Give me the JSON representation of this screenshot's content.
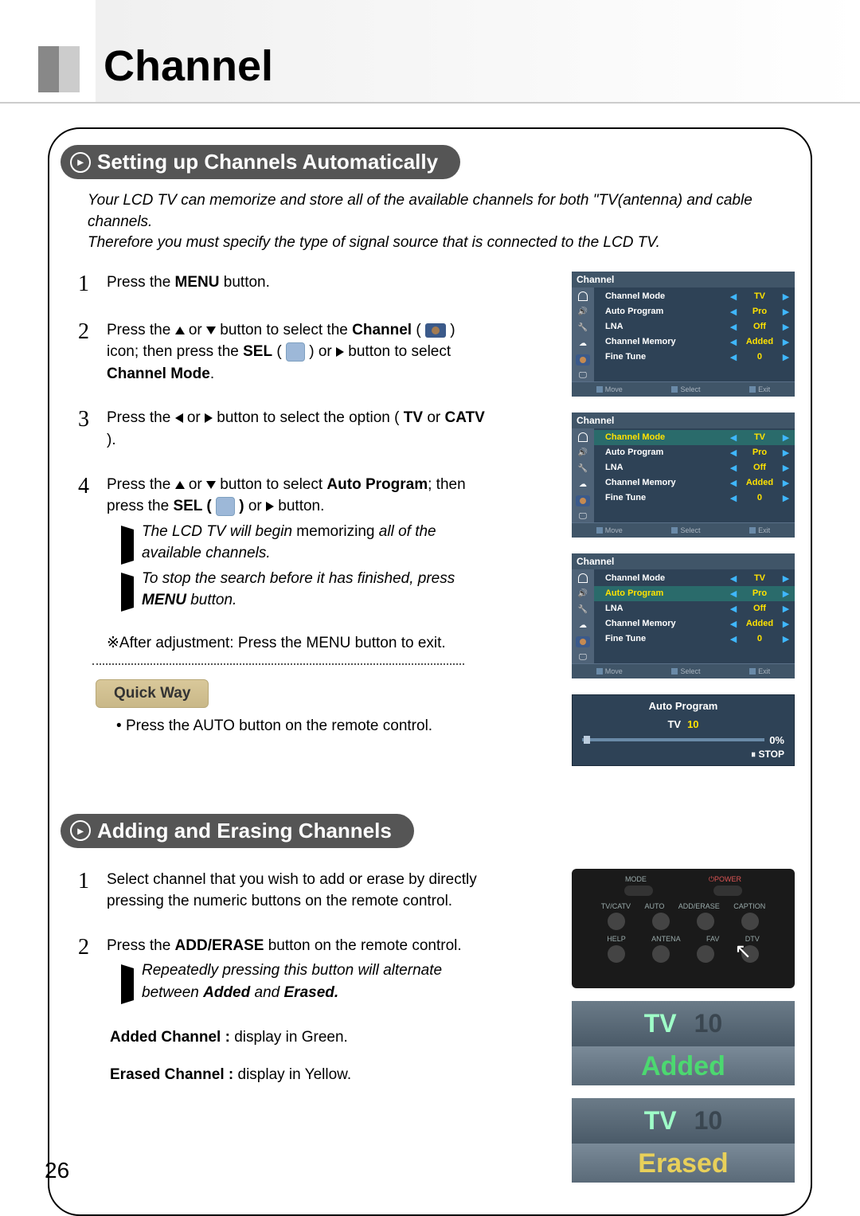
{
  "page_number": "26",
  "header_title": "Channel",
  "section1": {
    "title": "Setting up Channels Automatically",
    "intro": "Your LCD TV can memorize and store all of the available channels for both \"TV(antenna) and cable channels.\nTherefore you must specify the type of signal source that is connected to the LCD TV.",
    "steps": {
      "1": {
        "num": "1",
        "text_a": "Press the ",
        "bold_a": "MENU",
        "text_b": " button."
      },
      "2": {
        "num": "2",
        "text_a": "Press the ",
        "text_b": " or ",
        "text_c": " button to select the ",
        "bold_c": "Channel",
        "text_d": " ( ",
        "text_e": " ) icon; then press the ",
        "bold_e": "SEL",
        "text_f": " ( ",
        "text_g": " ) or ",
        "text_h": " button to select ",
        "bold_h": "Channel Mode",
        "text_i": "."
      },
      "3": {
        "num": "3",
        "text_a": "Press the ",
        "text_b": " or ",
        "text_c": " button to select the option ( ",
        "bold_c": "TV",
        "text_d": " or ",
        "bold_d": "CATV",
        "text_e": " )."
      },
      "4": {
        "num": "4",
        "text_a": "Press the ",
        "text_b": " or ",
        "text_c": " button to select ",
        "bold_c": "Auto Program",
        "text_d": "; then press the ",
        "bold_d": "SEL ( ",
        "text_e": " ) ",
        "text_f": "or ",
        "text_g": " button.",
        "sub1_a": "The LCD TV will begin ",
        "sub1_b": "memorizing ",
        "sub1_c": "all of the available channels.",
        "sub2_a": "To stop the search before it has finished, press ",
        "sub2_bold": "MENU",
        "sub2_c": " button."
      }
    },
    "after": {
      "prefix": "※",
      "bold": "After adjustment:",
      "text": " Press the ",
      "bold2": "MENU",
      "text2": " button to exit."
    },
    "quickway": {
      "title": "Quick Way",
      "text_a": "Press the ",
      "bold": "AUTO",
      "text_b": " button on the remote control."
    }
  },
  "section2": {
    "title": "Adding and Erasing Channels",
    "steps": {
      "1": {
        "num": "1",
        "text": "Select channel that you wish to add or erase by directly pressing the numeric buttons on the remote control."
      },
      "2": {
        "num": "2",
        "text_a": "Press the ",
        "bold": "ADD/ERASE",
        "text_b": " button on the remote control.",
        "sub_a": "Repeatedly pressing this button will alternate between ",
        "sub_bold": "Added",
        "sub_b": " and ",
        "sub_bold2": "Erased."
      }
    },
    "added_line": {
      "bold": "Added Channel : ",
      "text": "display in Green."
    },
    "erased_line": {
      "bold": "Erased Channel : ",
      "text": "display in Yellow."
    }
  },
  "osd": {
    "title": "Channel",
    "rows": {
      "mode": {
        "label": "Channel Mode",
        "value": "TV"
      },
      "auto": {
        "label": "Auto Program",
        "value": "Pro"
      },
      "lna": {
        "label": "LNA",
        "value": "Off"
      },
      "mem": {
        "label": "Channel Memory",
        "value": "Added"
      },
      "fine": {
        "label": "Fine Tune",
        "value": "0"
      }
    },
    "footer": {
      "move": "Move",
      "select": "Select",
      "exit": "Exit"
    }
  },
  "autoprog": {
    "title": "Auto Program",
    "tvlabel": "TV",
    "tvnum": "10",
    "percent": "0%",
    "stop": "STOP"
  },
  "remote": {
    "labels_row1": {
      "mode": "MODE",
      "power": "POWER"
    },
    "labels_row2": {
      "tvcatv": "TV/CATV",
      "auto": "AUTO",
      "adderase": "ADD/ERASE",
      "caption": "CAPTION"
    },
    "labels_row3": {
      "help": "HELP",
      "antena": "ANTENA",
      "fav": "FAV",
      "dtv": "DTV"
    }
  },
  "status": {
    "tv": "TV",
    "ch": "10",
    "added": "Added",
    "erased": "Erased"
  }
}
